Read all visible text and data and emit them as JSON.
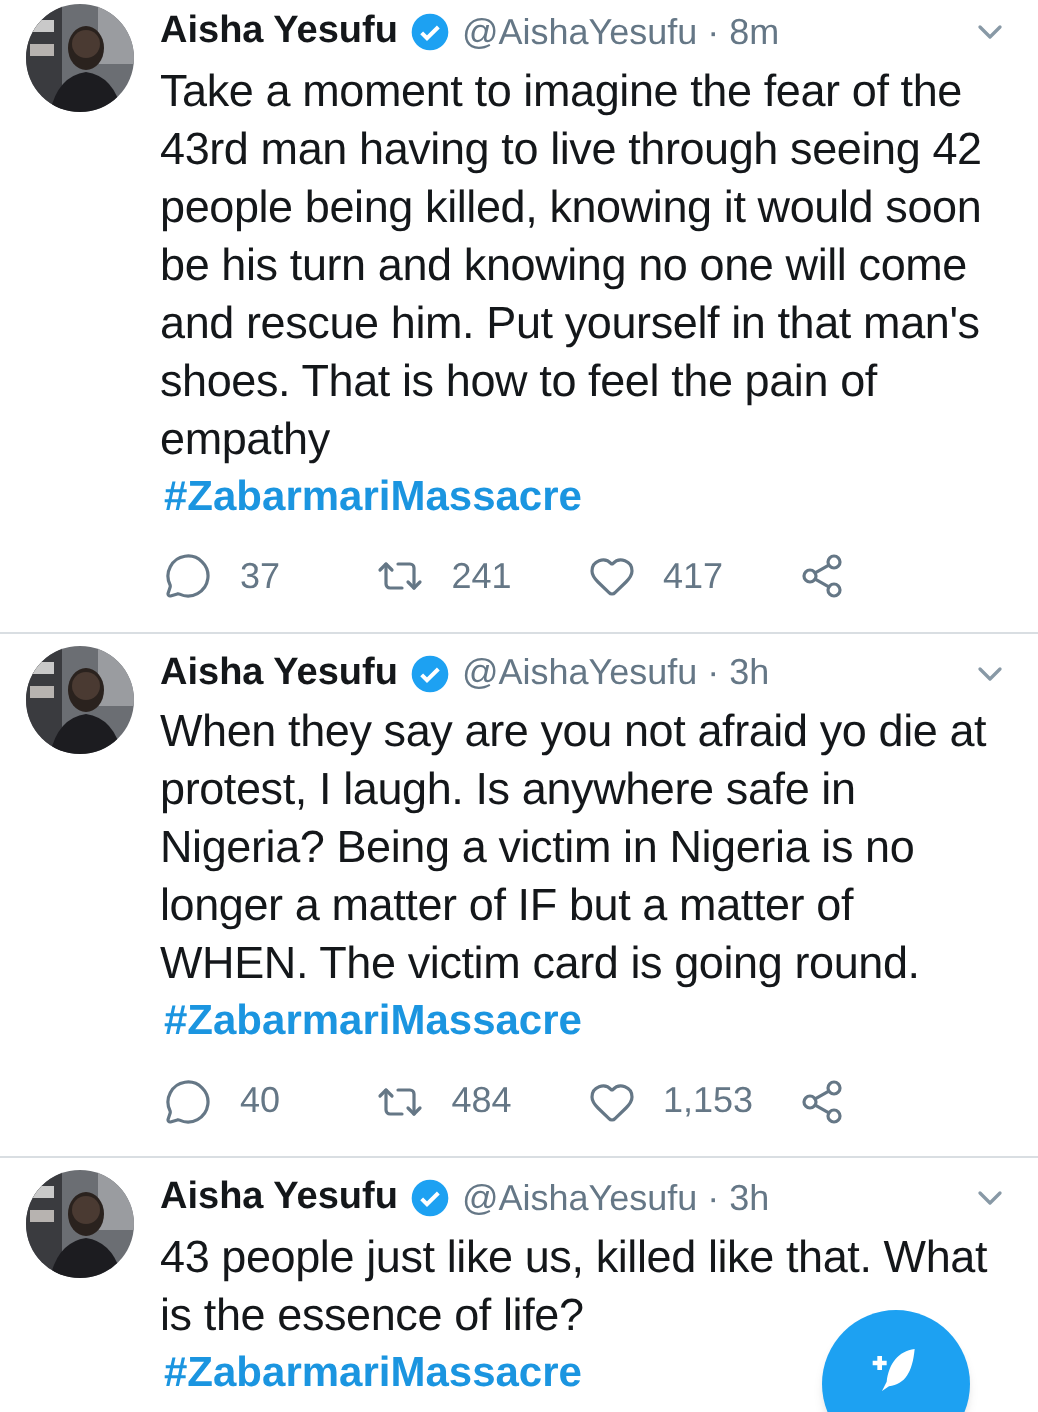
{
  "tweets": [
    {
      "name": "Aisha Yesufu",
      "verified": true,
      "handle": "@AishaYesufu · 8m",
      "text": "Take a moment to imagine the fear of the 43rd man having to live through seeing 42 people being killed, knowing it would soon be his turn and knowing no one will come and rescue him. Put yourself in that man's shoes. That is how to feel the pain of empathy",
      "hashtag": "#ZabarmariMassacre",
      "actions": {
        "replies": "37",
        "retweets": "241",
        "likes": "417"
      }
    },
    {
      "name": "Aisha Yesufu",
      "verified": true,
      "handle": "@AishaYesufu · 3h",
      "text": "When they say are you not afraid yo die at protest, I laugh. Is anywhere safe in Nigeria? Being a victim in Nigeria is no longer a matter of IF but a matter of WHEN. The victim card is going round.",
      "hashtag": "#ZabarmariMassacre",
      "actions": {
        "replies": "40",
        "retweets": "484",
        "likes": "1,153"
      }
    },
    {
      "name": "Aisha Yesufu",
      "verified": true,
      "handle": "@AishaYesufu · 3h",
      "text": "43 people just like us, killed like that. What is the essence of life?",
      "hashtag": "#ZabarmariMassacre"
    }
  ]
}
